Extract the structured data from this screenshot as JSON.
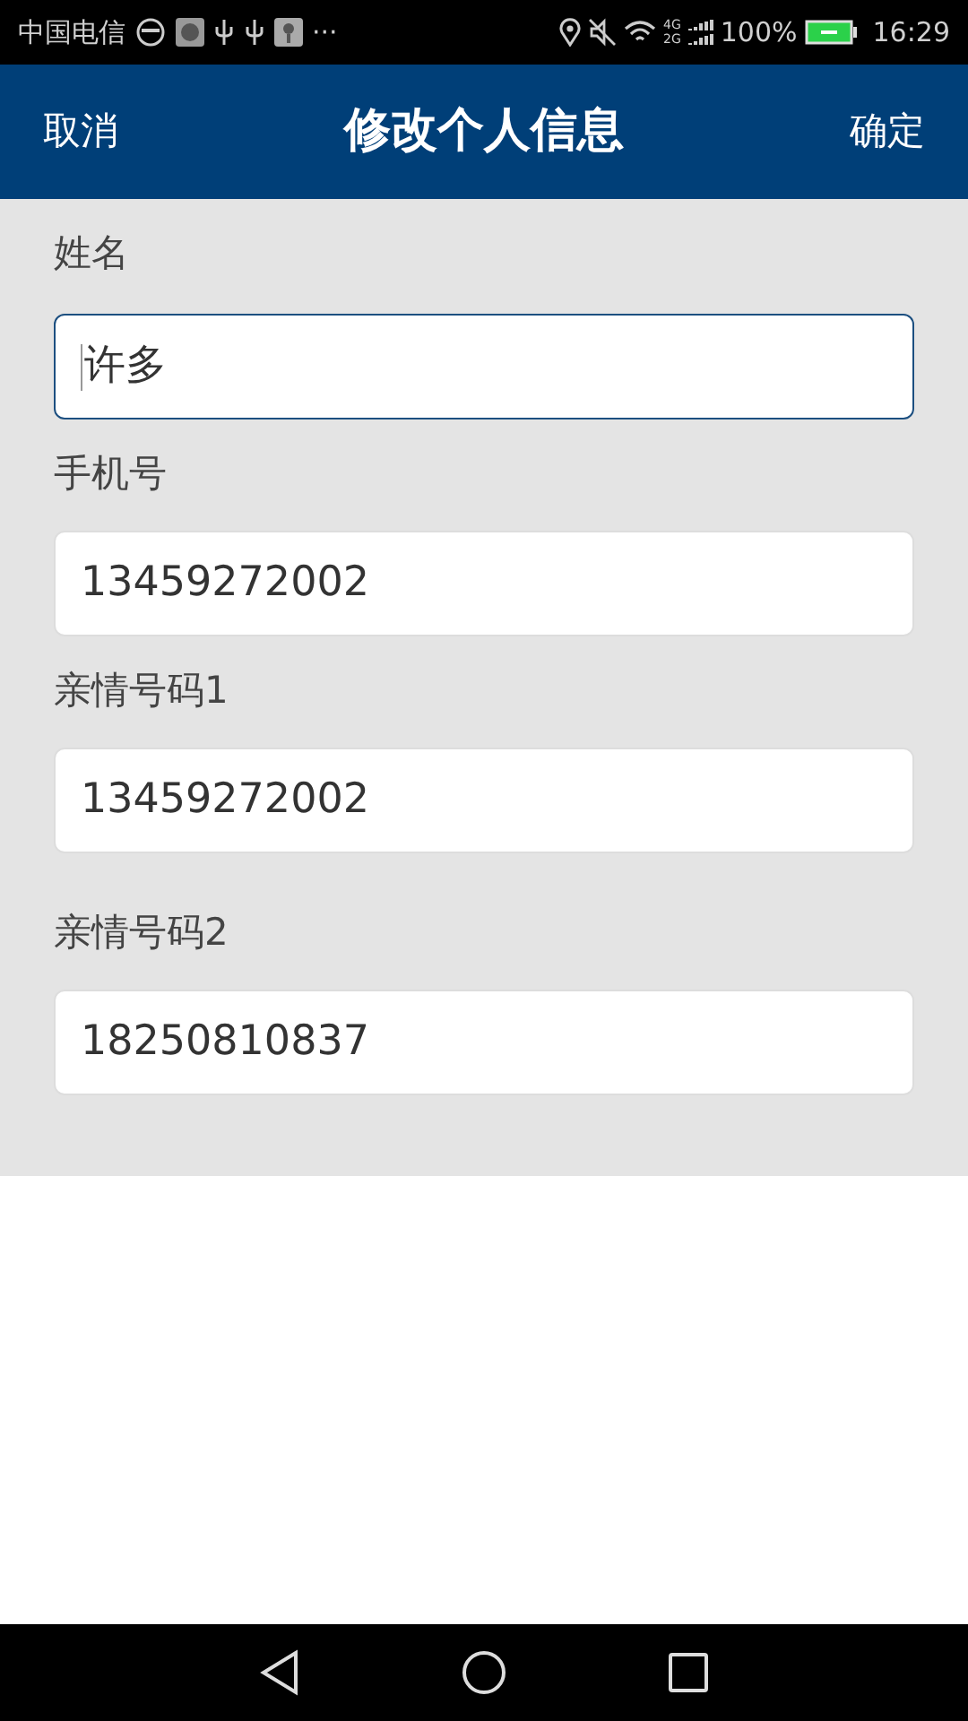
{
  "status_bar": {
    "carrier": "中国电信",
    "more": "···",
    "network_top": "4G",
    "network_bottom": "2G",
    "battery_text": "100%",
    "time": "16:29"
  },
  "header": {
    "cancel": "取消",
    "title": "修改个人信息",
    "confirm": "确定"
  },
  "fields": [
    {
      "label": "姓名",
      "value": "许多",
      "focused": true
    },
    {
      "label": "手机号",
      "value": "13459272002",
      "focused": false
    },
    {
      "label": "亲情号码1",
      "value": "13459272002",
      "focused": false
    },
    {
      "label": "亲情号码2",
      "value": "18250810837",
      "focused": false
    }
  ]
}
